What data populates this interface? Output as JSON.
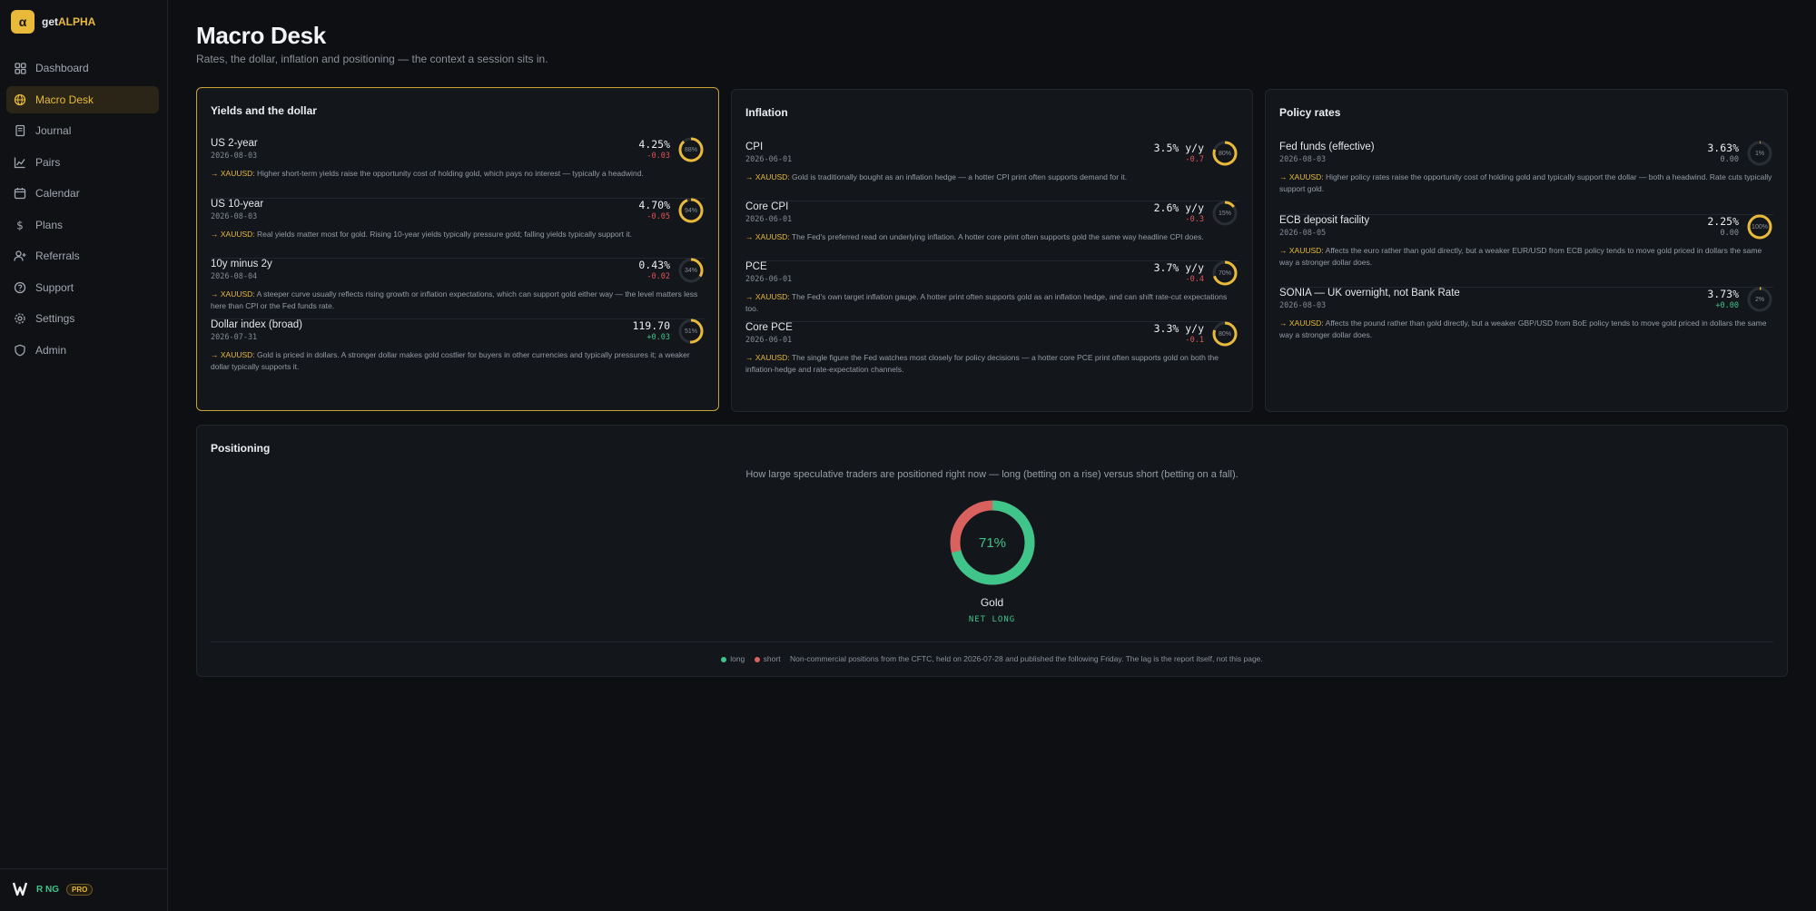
{
  "app": {
    "brand_prefix": "get",
    "brand_accent": "ALPHA",
    "brand_mark": "α"
  },
  "sidebar": {
    "items": [
      {
        "label": "Dashboard",
        "icon": "grid-icon",
        "active": false
      },
      {
        "label": "Macro Desk",
        "icon": "globe-icon",
        "active": true
      },
      {
        "label": "Journal",
        "icon": "book-icon",
        "active": false
      },
      {
        "label": "Pairs",
        "icon": "chart-line-icon",
        "active": false
      },
      {
        "label": "Calendar",
        "icon": "calendar-icon",
        "active": false
      },
      {
        "label": "Plans",
        "icon": "dollar-icon",
        "active": false
      },
      {
        "label": "Referrals",
        "icon": "user-plus-icon",
        "active": false
      },
      {
        "label": "Support",
        "icon": "help-circle-icon",
        "active": false
      },
      {
        "label": "Settings",
        "icon": "gear-icon",
        "active": false
      },
      {
        "label": "Admin",
        "icon": "shield-icon",
        "active": false
      }
    ],
    "user": {
      "name": "R NG",
      "badge": "PRO"
    }
  },
  "header": {
    "title": "Macro Desk",
    "subtitle": "Rates, the dollar, inflation and positioning — the context a session sits in."
  },
  "arrow_prefix": "→ XAUUSD:",
  "cards": [
    {
      "title": "Yields and the dollar",
      "rows": [
        {
          "name": "US 2-year",
          "date": "2026-08-03",
          "value": "4.25%",
          "change": "-0.03",
          "dir": "neg",
          "gauge_pct": 88,
          "gauge_label": "88%",
          "note": "Higher short-term yields raise the opportunity cost of holding gold, which pays no interest — typically a headwind."
        },
        {
          "name": "US 10-year",
          "date": "2026-08-03",
          "value": "4.70%",
          "change": "-0.05",
          "dir": "neg",
          "gauge_pct": 94,
          "gauge_label": "94%",
          "note": "Real yields matter most for gold. Rising 10-year yields typically pressure gold; falling yields typically support it."
        },
        {
          "name": "10y minus 2y",
          "date": "2026-08-04",
          "value": "0.43%",
          "change": "-0.02",
          "dir": "neg",
          "gauge_pct": 34,
          "gauge_label": "34%",
          "note": "A steeper curve usually reflects rising growth or inflation expectations, which can support gold either way — the level matters less here than CPI or the Fed funds rate."
        },
        {
          "name": "Dollar index (broad)",
          "date": "2026-07-31",
          "value": "119.70",
          "change": "+0.03",
          "dir": "pos",
          "gauge_pct": 51,
          "gauge_label": "51%",
          "note": "Gold is priced in dollars. A stronger dollar makes gold costlier for buyers in other currencies and typically pressures it; a weaker dollar typically supports it."
        }
      ]
    },
    {
      "title": "Inflation",
      "rows": [
        {
          "name": "CPI",
          "date": "2026-06-01",
          "value": "3.5% y/y",
          "change": "-0.7",
          "dir": "neg",
          "gauge_pct": 80,
          "gauge_label": "80%",
          "note": "Gold is traditionally bought as an inflation hedge — a hotter CPI print often supports demand for it."
        },
        {
          "name": "Core CPI",
          "date": "2026-06-01",
          "value": "2.6% y/y",
          "change": "-0.3",
          "dir": "neg",
          "gauge_pct": 15,
          "gauge_label": "15%",
          "note": "The Fed's preferred read on underlying inflation. A hotter core print often supports gold the same way headline CPI does."
        },
        {
          "name": "PCE",
          "date": "2026-06-01",
          "value": "3.7% y/y",
          "change": "-0.4",
          "dir": "neg",
          "gauge_pct": 70,
          "gauge_label": "70%",
          "note": "The Fed's own target inflation gauge. A hotter print often supports gold as an inflation hedge, and can shift rate-cut expectations too."
        },
        {
          "name": "Core PCE",
          "date": "2026-06-01",
          "value": "3.3% y/y",
          "change": "-0.1",
          "dir": "neg",
          "gauge_pct": 80,
          "gauge_label": "80%",
          "note": "The single figure the Fed watches most closely for policy decisions — a hotter core PCE print often supports gold on both the inflation-hedge and rate-expectation channels."
        }
      ]
    },
    {
      "title": "Policy rates",
      "rows": [
        {
          "name": "Fed funds (effective)",
          "date": "2026-08-03",
          "value": "3.63%",
          "change": "0.00",
          "dir": "flat",
          "gauge_pct": 1,
          "gauge_label": "1%",
          "note": "Higher policy rates raise the opportunity cost of holding gold and typically support the dollar — both a headwind. Rate cuts typically support gold."
        },
        {
          "name": "ECB deposit facility",
          "date": "2026-08-05",
          "value": "2.25%",
          "change": "0.00",
          "dir": "flat",
          "gauge_pct": 100,
          "gauge_label": "100%",
          "note": "Affects the euro rather than gold directly, but a weaker EUR/USD from ECB policy tends to move gold priced in dollars the same way a stronger dollar does."
        },
        {
          "name": "SONIA — UK overnight, not Bank Rate",
          "date": "2026-08-03",
          "value": "3.73%",
          "change": "+0.00",
          "dir": "pos",
          "gauge_pct": 2,
          "gauge_label": "2%",
          "note": "Affects the pound rather than gold directly, but a weaker GBP/USD from BoE policy tends to move gold priced in dollars the same way a stronger dollar does."
        }
      ]
    }
  ],
  "positioning": {
    "title": "Positioning",
    "description": "How large speculative traders are positioned right now — long (betting on a rise) versus short (betting on a fall).",
    "asset": "Gold",
    "long_pct": 71,
    "long_label": "71%",
    "status": "NET LONG",
    "legend_long": "long",
    "legend_short": "short",
    "footnote": "Non-commercial positions from the CFTC, held on 2026-07-28 and published the following Friday. The lag is the report itself, not this page."
  },
  "colors": {
    "accent": "#e9b93a",
    "long": "#3fc48a",
    "short": "#d9625f",
    "negative": "#e0555a",
    "gauge_track": "#2a2e36"
  }
}
